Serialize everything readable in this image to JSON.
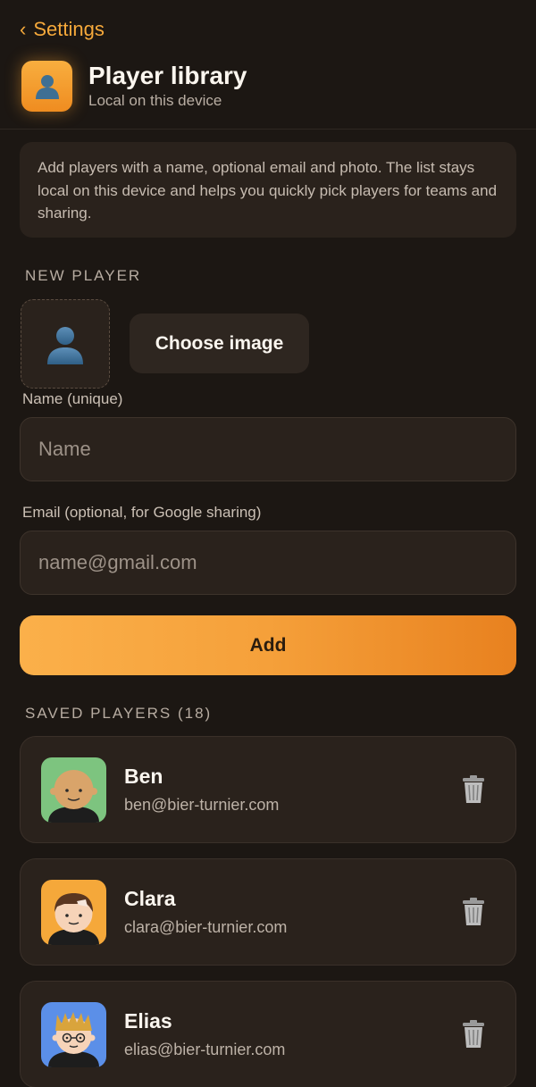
{
  "nav": {
    "back_label": "Settings"
  },
  "header": {
    "icon": "person-icon",
    "title": "Player library",
    "subtitle": "Local on this device"
  },
  "info_text": "Add players with a name, optional email and photo. The list stays local on this device and helps you quickly pick players for teams and sharing.",
  "new_player": {
    "section_label": "NEW PLAYER",
    "choose_image_label": "Choose image",
    "name_label": "Name (unique)",
    "name_placeholder": "Name",
    "name_value": "",
    "email_label": "Email (optional, for Google sharing)",
    "email_placeholder": "name@gmail.com",
    "email_value": "",
    "add_label": "Add"
  },
  "saved": {
    "section_label": "SAVED PLAYERS (18)",
    "players": [
      {
        "name": "Ben",
        "email": "ben@bier-turnier.com",
        "avatar_bg": "#7dc47f",
        "avatar": "bald-man-avatar"
      },
      {
        "name": "Clara",
        "email": "clara@bier-turnier.com",
        "avatar_bg": "#f5a83a",
        "avatar": "brown-hair-avatar"
      },
      {
        "name": "Elias",
        "email": "elias@bier-turnier.com",
        "avatar_bg": "#5b8fe8",
        "avatar": "spiky-hair-glasses-avatar"
      }
    ]
  },
  "colors": {
    "accent": "#f6a93b",
    "background": "#1c1713",
    "card": "#2a221c"
  }
}
